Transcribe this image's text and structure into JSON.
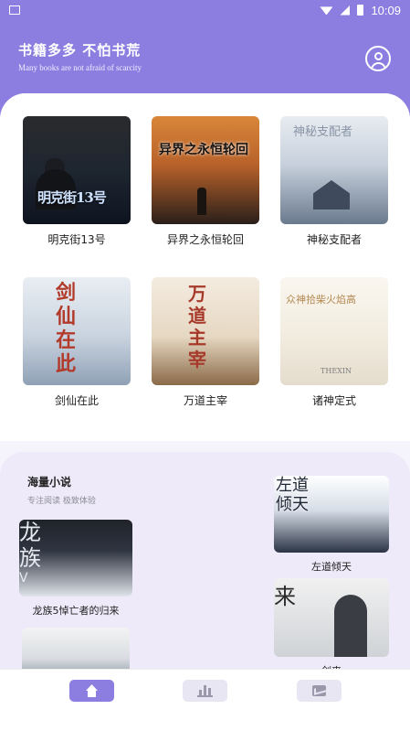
{
  "status_bar": {
    "time": "10:09"
  },
  "header": {
    "title": "书籍多多 不怕书荒",
    "subtitle": "Many books are not afraid of scarcity"
  },
  "books": [
    {
      "title": "明克街13号",
      "cover_text": "明克街13号"
    },
    {
      "title": "异界之永恒轮回",
      "cover_text": "异界之永恒轮回"
    },
    {
      "title": "神秘支配者",
      "cover_text": "神秘支配者"
    },
    {
      "title": "剑仙在此",
      "cover_text": "剑仙在此"
    },
    {
      "title": "万道主宰",
      "cover_text": "万道主宰"
    },
    {
      "title": "诸神定式",
      "cover_text": "众神拾柴火焰高",
      "cover_sub": "THEXIN"
    }
  ],
  "sea_section": {
    "title": "海量小说",
    "subtitle": "专注阅读  极致体验",
    "books": [
      {
        "title": "龙族5悼亡者的归来",
        "cover_text": "龙族",
        "cover_sub": "V"
      },
      {
        "title": "左道倾天",
        "cover_text": "左道倾天"
      },
      {
        "title": "剑来",
        "cover_text": "来"
      }
    ]
  },
  "bottom_nav": [
    {
      "icon": "home-icon"
    },
    {
      "icon": "ranking-icon"
    },
    {
      "icon": "mail-icon"
    }
  ],
  "colors": {
    "accent": "#8b7ee0",
    "section_bg": "#eeeaf9"
  }
}
